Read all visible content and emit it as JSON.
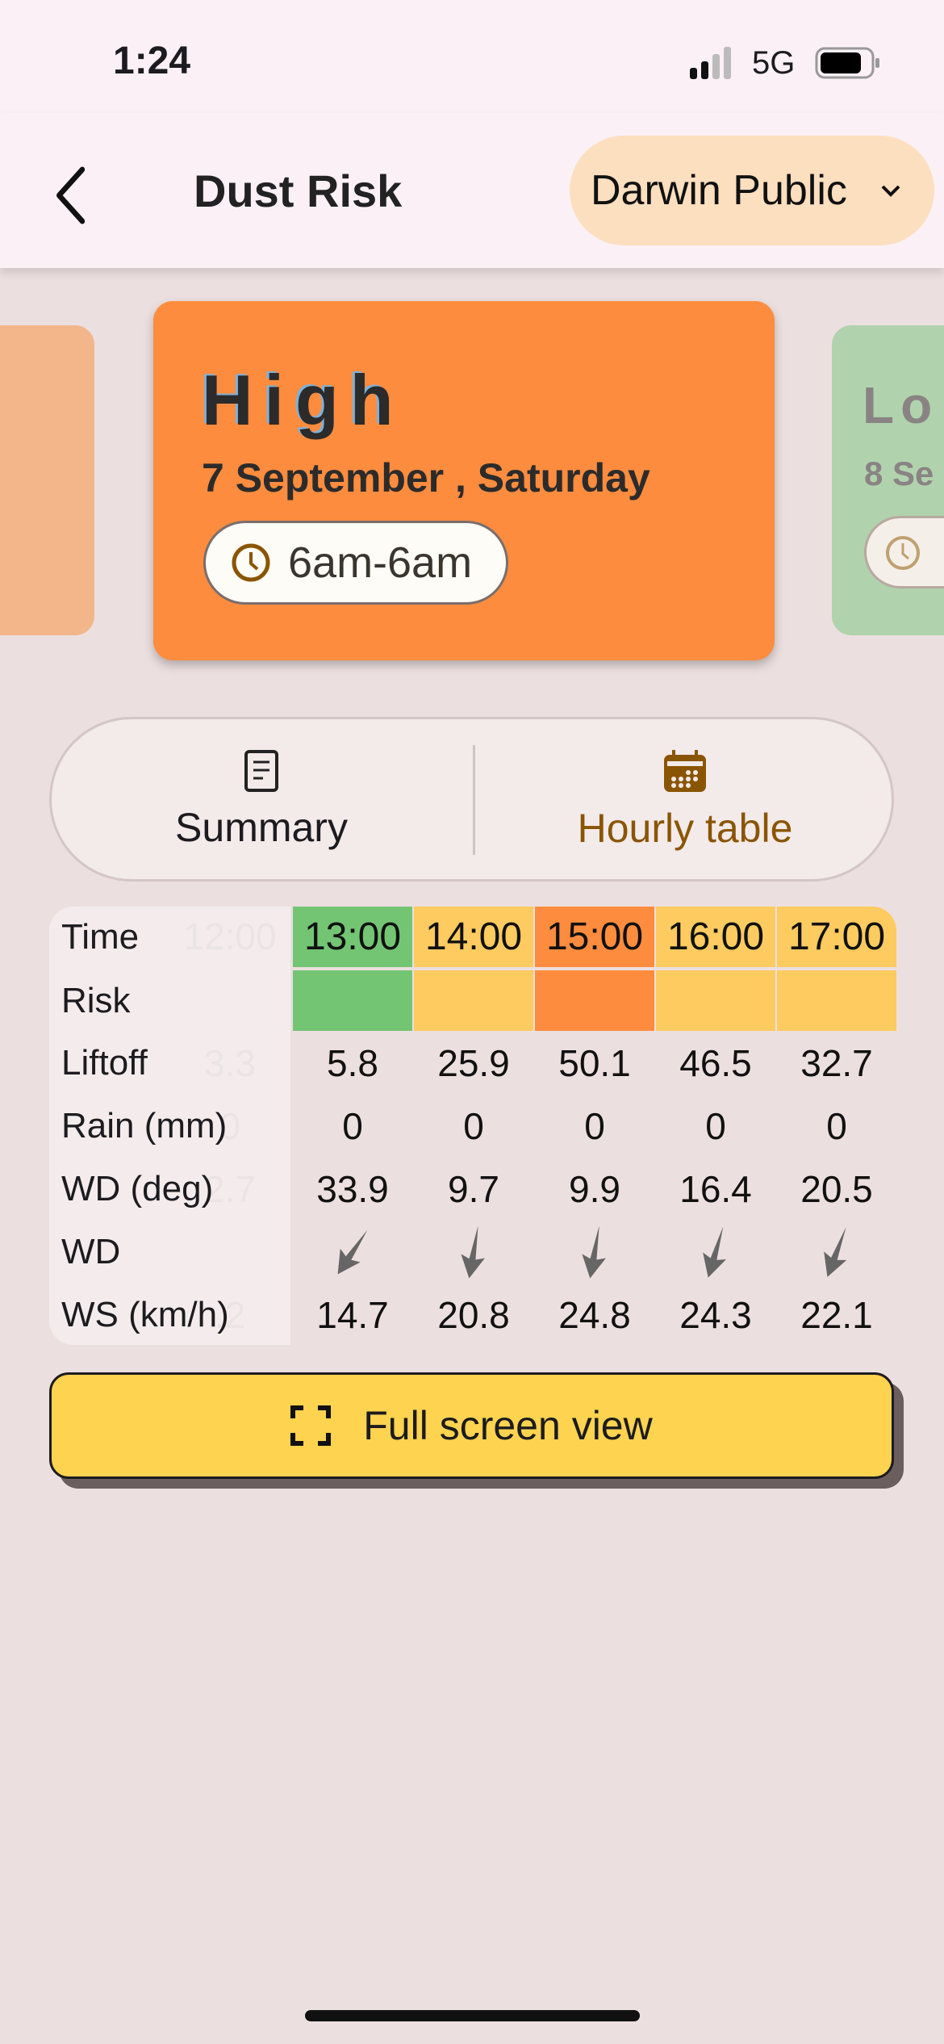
{
  "status_bar": {
    "time": "1:24",
    "network": "5G"
  },
  "header": {
    "title": "Dust Risk",
    "location": "Darwin Public"
  },
  "cards": {
    "current": {
      "level": "High",
      "date": "7 September , Saturday",
      "time_range": "6am-6am",
      "color": "#fd8c3e"
    },
    "next": {
      "level": "Lo",
      "date": "8 Se",
      "color": "#b0d3ad"
    },
    "previous": {
      "color": "#f3b68b"
    }
  },
  "tabs": [
    {
      "label": "Summary",
      "icon": "document-icon",
      "active": false
    },
    {
      "label": "Hourly table",
      "icon": "calendar-icon",
      "active": true
    }
  ],
  "table": {
    "row_labels": [
      "Time",
      "Risk",
      "Liftoff",
      "Rain (mm)",
      "WD (deg)",
      "WD",
      "WS (km/h)"
    ],
    "ghost_column": {
      "time": "12:00",
      "liftoff": "3.3",
      "rain": "0",
      "wd_deg": "2.7",
      "ws": ".2"
    },
    "columns": [
      {
        "time": "13:00",
        "risk_color": "#73c573",
        "liftoff": "5.8",
        "rain": "0",
        "wd_deg": "33.9",
        "ws": "14.7"
      },
      {
        "time": "14:00",
        "risk_color": "#fdcb5f",
        "liftoff": "25.9",
        "rain": "0",
        "wd_deg": "9.7",
        "ws": "20.8"
      },
      {
        "time": "15:00",
        "risk_color": "#fd8c3e",
        "liftoff": "50.1",
        "rain": "0",
        "wd_deg": "9.9",
        "ws": "24.8"
      },
      {
        "time": "16:00",
        "risk_color": "#fdcb5f",
        "liftoff": "46.5",
        "rain": "0",
        "wd_deg": "16.4",
        "ws": "24.3"
      },
      {
        "time": "17:00",
        "risk_color": "#fdcb5f",
        "liftoff": "32.7",
        "rain": "0",
        "wd_deg": "20.5",
        "ws": "22.1"
      }
    ]
  },
  "full_screen_button": {
    "label": "Full screen view"
  },
  "colors": {
    "accent": "#8a5500",
    "button": "#fdd34f",
    "header_bg": "#fbf0f5",
    "page_bg": "#ecdfdf"
  }
}
